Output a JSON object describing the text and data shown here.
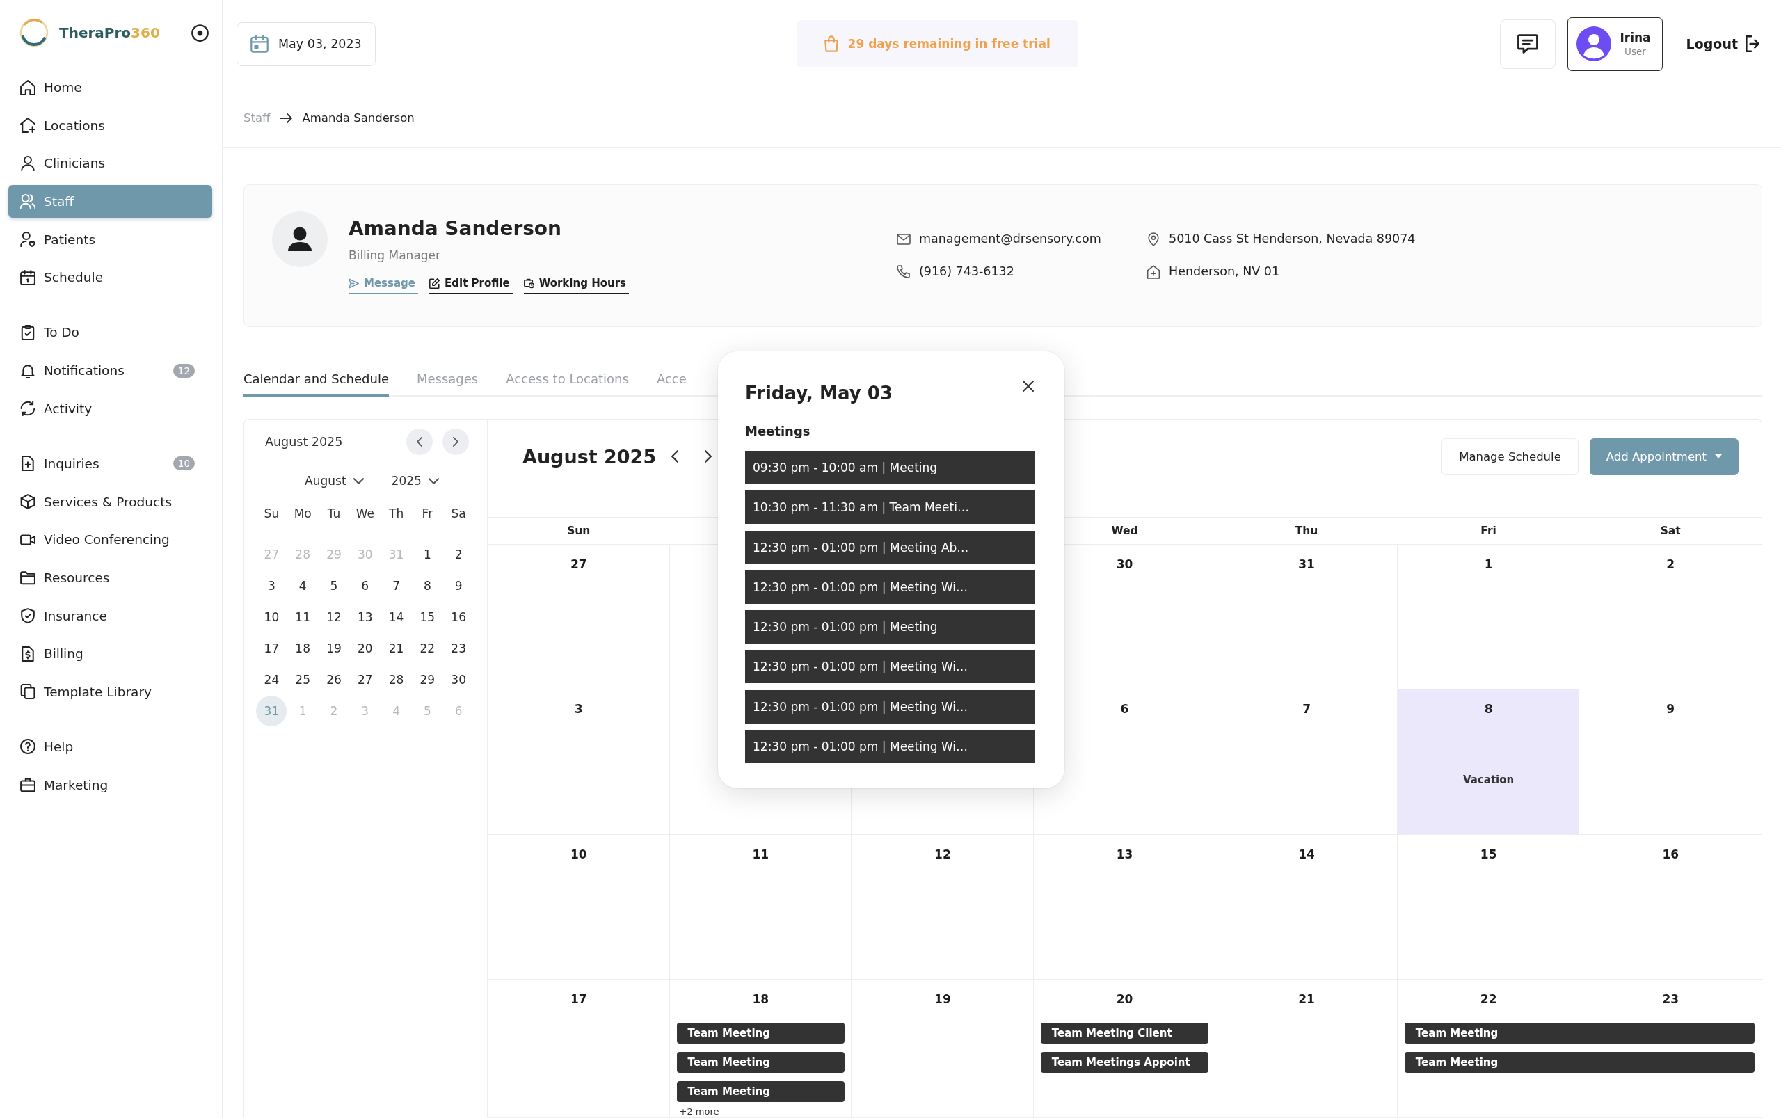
{
  "sidebar": {
    "brand": {
      "name": "TheraPro",
      "suffix": "360"
    },
    "sections": [
      {
        "items": [
          {
            "label": "Home",
            "selected": false
          },
          {
            "label": "Locations",
            "selected": false
          },
          {
            "label": "Clinicians",
            "selected": false
          },
          {
            "label": "Staff",
            "selected": true
          },
          {
            "label": "Patients",
            "selected": false
          },
          {
            "label": "Schedule",
            "selected": false
          }
        ]
      },
      {
        "items": [
          {
            "label": "To Do",
            "selected": false
          },
          {
            "label": "Notifications",
            "selected": false,
            "badge": "12"
          },
          {
            "label": "Activity",
            "selected": false
          }
        ]
      },
      {
        "items": [
          {
            "label": "Inquiries",
            "selected": false,
            "badge": "10"
          },
          {
            "label": "Services & Products",
            "selected": false
          },
          {
            "label": "Video Conferencing",
            "selected": false
          },
          {
            "label": "Resources",
            "selected": false
          },
          {
            "label": "Insurance",
            "selected": false
          },
          {
            "label": "Billing",
            "selected": false
          },
          {
            "label": "Template Library",
            "selected": false
          }
        ]
      },
      {
        "items": [
          {
            "label": "Help",
            "selected": false
          },
          {
            "label": "Marketing",
            "selected": false
          }
        ]
      }
    ]
  },
  "header": {
    "date": "May 03, 2023",
    "trial": "29 days remaining in free trial",
    "user": {
      "name": "Irina",
      "role": "User"
    },
    "logout": "Logout"
  },
  "breadcrumb": [
    {
      "label": "Staff",
      "current": false
    },
    {
      "label": "Amanda Sanderson",
      "current": true
    }
  ],
  "profile": {
    "name": "Amanda Sanderson",
    "role": "Billing Manager",
    "actions": [
      {
        "label": "Message",
        "selected": true
      },
      {
        "label": "Edit Profile",
        "selected": false
      },
      {
        "label": "Working Hours",
        "selected": false
      }
    ],
    "contacts": [
      {
        "kind": "email",
        "value": "management@drsensory.com"
      },
      {
        "kind": "address",
        "value": "5010 Cass St Henderson, Nevada 89074"
      },
      {
        "kind": "phone",
        "value": "(916) 743-6132"
      },
      {
        "kind": "location",
        "value": "Henderson, NV 01"
      }
    ]
  },
  "tabs": [
    {
      "label": "Calendar and Schedule",
      "selected": true
    },
    {
      "label": "Messages",
      "selected": false
    },
    {
      "label": "Access to Locations",
      "selected": false
    },
    {
      "label": "Acce",
      "selected": false
    }
  ],
  "mini_calendar": {
    "title": "August 2025",
    "month": "August",
    "year": "2025",
    "weekdays": [
      "Su",
      "Mo",
      "Tu",
      "We",
      "Th",
      "Fr",
      "Sa"
    ],
    "days": [
      {
        "day": "27",
        "outside": true,
        "selected": false
      },
      {
        "day": "28",
        "outside": true,
        "selected": false
      },
      {
        "day": "29",
        "outside": true,
        "selected": false
      },
      {
        "day": "30",
        "outside": true,
        "selected": false
      },
      {
        "day": "31",
        "outside": true,
        "selected": false
      },
      {
        "day": "1",
        "outside": false,
        "selected": false
      },
      {
        "day": "2",
        "outside": false,
        "selected": false
      },
      {
        "day": "3",
        "outside": false,
        "selected": false
      },
      {
        "day": "4",
        "outside": false,
        "selected": false
      },
      {
        "day": "5",
        "outside": false,
        "selected": false
      },
      {
        "day": "6",
        "outside": false,
        "selected": false
      },
      {
        "day": "7",
        "outside": false,
        "selected": false
      },
      {
        "day": "8",
        "outside": false,
        "selected": false
      },
      {
        "day": "9",
        "outside": false,
        "selected": false
      },
      {
        "day": "10",
        "outside": false,
        "selected": false
      },
      {
        "day": "11",
        "outside": false,
        "selected": false
      },
      {
        "day": "12",
        "outside": false,
        "selected": false
      },
      {
        "day": "13",
        "outside": false,
        "selected": false
      },
      {
        "day": "14",
        "outside": false,
        "selected": false
      },
      {
        "day": "15",
        "outside": false,
        "selected": false
      },
      {
        "day": "16",
        "outside": false,
        "selected": false
      },
      {
        "day": "17",
        "outside": false,
        "selected": false
      },
      {
        "day": "18",
        "outside": false,
        "selected": false
      },
      {
        "day": "19",
        "outside": false,
        "selected": false
      },
      {
        "day": "20",
        "outside": false,
        "selected": false
      },
      {
        "day": "21",
        "outside": false,
        "selected": false
      },
      {
        "day": "22",
        "outside": false,
        "selected": false
      },
      {
        "day": "23",
        "outside": false,
        "selected": false
      },
      {
        "day": "24",
        "outside": false,
        "selected": false
      },
      {
        "day": "25",
        "outside": false,
        "selected": false
      },
      {
        "day": "26",
        "outside": false,
        "selected": false
      },
      {
        "day": "27",
        "outside": false,
        "selected": false
      },
      {
        "day": "28",
        "outside": false,
        "selected": false
      },
      {
        "day": "29",
        "outside": false,
        "selected": false
      },
      {
        "day": "30",
        "outside": false,
        "selected": false
      },
      {
        "day": "31",
        "outside": false,
        "selected": true
      },
      {
        "day": "1",
        "outside": true,
        "selected": false
      },
      {
        "day": "2",
        "outside": true,
        "selected": false
      },
      {
        "day": "3",
        "outside": true,
        "selected": false
      },
      {
        "day": "4",
        "outside": true,
        "selected": false
      },
      {
        "day": "5",
        "outside": true,
        "selected": false
      },
      {
        "day": "6",
        "outside": true,
        "selected": false
      }
    ]
  },
  "calendar": {
    "title": "August 2025",
    "buttons": [
      {
        "label": "Manage Schedule",
        "kind": "outline"
      },
      {
        "label": "Add Appointment",
        "kind": "dropdown"
      }
    ],
    "weekdays": [
      {
        "kind": "day",
        "label": "Sun"
      },
      {
        "kind": "covered"
      },
      {
        "kind": "covered"
      },
      {
        "kind": "day",
        "label": "Wed"
      },
      {
        "kind": "day",
        "label": "Thu"
      },
      {
        "kind": "day",
        "label": "Fri"
      },
      {
        "kind": "day",
        "label": "Sat"
      }
    ],
    "weeks": [
      {
        "days": [
          {
            "kind": "day",
            "date": "27",
            "highlighted": false
          },
          {
            "kind": "covered"
          },
          {
            "kind": "hidden"
          },
          {
            "kind": "day",
            "date": "30",
            "highlighted": false
          },
          {
            "kind": "day",
            "date": "31",
            "highlighted": false
          },
          {
            "kind": "day",
            "date": "1",
            "highlighted": false
          },
          {
            "kind": "day",
            "date": "2",
            "highlighted": false
          }
        ]
      },
      {
        "days": [
          {
            "kind": "day",
            "date": "3",
            "highlighted": false
          },
          {
            "kind": "covered"
          },
          {
            "kind": "covered"
          },
          {
            "kind": "day",
            "date": "6",
            "highlighted": false
          },
          {
            "kind": "day",
            "date": "7",
            "highlighted": false
          },
          {
            "kind": "day",
            "date": "8",
            "highlighted": true,
            "note": "Vacation"
          },
          {
            "kind": "day",
            "date": "9",
            "highlighted": false
          }
        ]
      },
      {
        "days": [
          {
            "kind": "day",
            "date": "10",
            "highlighted": false
          },
          {
            "kind": "day",
            "date": "11",
            "highlighted": false
          },
          {
            "kind": "day",
            "date": "12",
            "highlighted": false
          },
          {
            "kind": "day",
            "date": "13",
            "highlighted": false
          },
          {
            "kind": "day",
            "date": "14",
            "highlighted": false
          },
          {
            "kind": "day",
            "date": "15",
            "highlighted": false
          },
          {
            "kind": "day",
            "date": "16",
            "highlighted": false
          }
        ]
      },
      {
        "days": [
          {
            "kind": "day",
            "date": "17",
            "highlighted": false
          },
          {
            "kind": "day",
            "date": "18",
            "highlighted": false,
            "events": [
              {
                "label": "Team Meeting",
                "kind": "single"
              },
              {
                "label": "Team Meeting",
                "kind": "single"
              },
              {
                "label": "Team Meeting",
                "kind": "single"
              }
            ],
            "more": "+2 more"
          },
          {
            "kind": "day",
            "date": "19",
            "highlighted": false
          },
          {
            "kind": "day",
            "date": "20",
            "highlighted": false,
            "events": [
              {
                "label": "Team Meeting Client",
                "kind": "single"
              },
              {
                "label": "Team Meetings Appoint",
                "kind": "single"
              }
            ]
          },
          {
            "kind": "day",
            "date": "21",
            "highlighted": false
          },
          {
            "kind": "day",
            "date": "22",
            "highlighted": false,
            "events": [
              {
                "label": "Team Meeting",
                "kind": "two-day"
              },
              {
                "label": "Team Meeting",
                "kind": "two-day"
              }
            ]
          },
          {
            "kind": "day",
            "date": "23",
            "highlighted": false
          }
        ]
      }
    ]
  },
  "popup": {
    "title": "Friday, May 03",
    "heading": "Meetings",
    "events": [
      "09:30 pm - 10:00 am | Meeting",
      "10:30 pm - 11:30 am | Team Meeti…",
      "12:30 pm - 01:00 pm | Meeting Ab…",
      "12:30 pm - 01:00 pm | Meeting Wi…",
      "12:30 pm - 01:00 pm | Meeting",
      "12:30 pm - 01:00 pm | Meeting Wi…",
      "12:30 pm - 01:00 pm | Meeting Wi…",
      "12:30 pm - 01:00 pm | Meeting Wi…"
    ]
  }
}
